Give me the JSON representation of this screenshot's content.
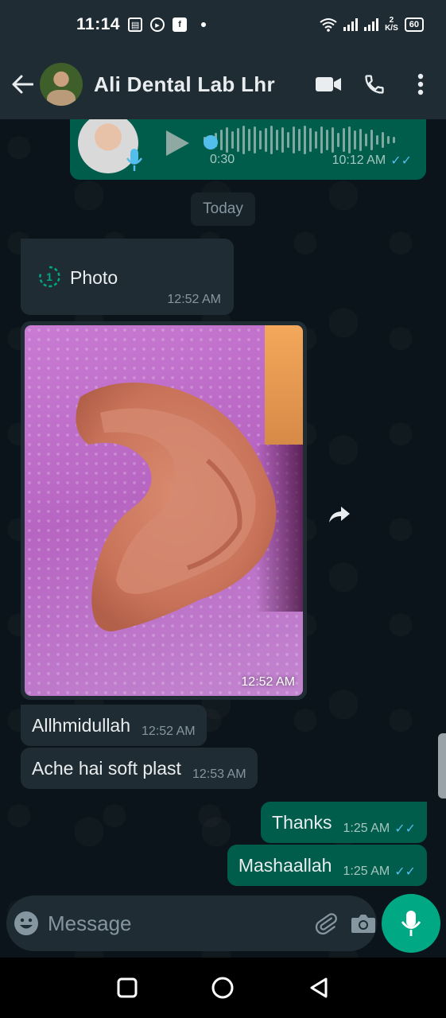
{
  "status_bar": {
    "time": "11:14",
    "speed_top": "2",
    "speed_unit": "K/S",
    "battery": "60"
  },
  "header": {
    "contact_name": "Ali Dental Lab Lhr",
    "icons": [
      "back-arrow-icon",
      "video-call-icon",
      "phone-icon",
      "more-vert-icon"
    ]
  },
  "messages": {
    "voice": {
      "duration": "0:30",
      "time": "10:12 AM"
    },
    "date_chip": "Today",
    "photo_label": {
      "text": "Photo",
      "time": "12:52 AM"
    },
    "photo_image": {
      "time": "12:52 AM"
    },
    "incoming": [
      {
        "text": "Allhmidullah",
        "time": "12:52 AM"
      },
      {
        "text": "Ache hai soft plast",
        "time": "12:53 AM"
      }
    ],
    "outgoing": [
      {
        "text": "Thanks",
        "time": "1:25 AM"
      },
      {
        "text": "Mashaallah",
        "time": "1:25 AM"
      }
    ]
  },
  "composer": {
    "placeholder": "Message"
  },
  "colors": {
    "outgoing_bubble": "#005c4b",
    "incoming_bubble": "#202c33",
    "accent": "#00a884",
    "read_tick": "#53bdeb"
  }
}
